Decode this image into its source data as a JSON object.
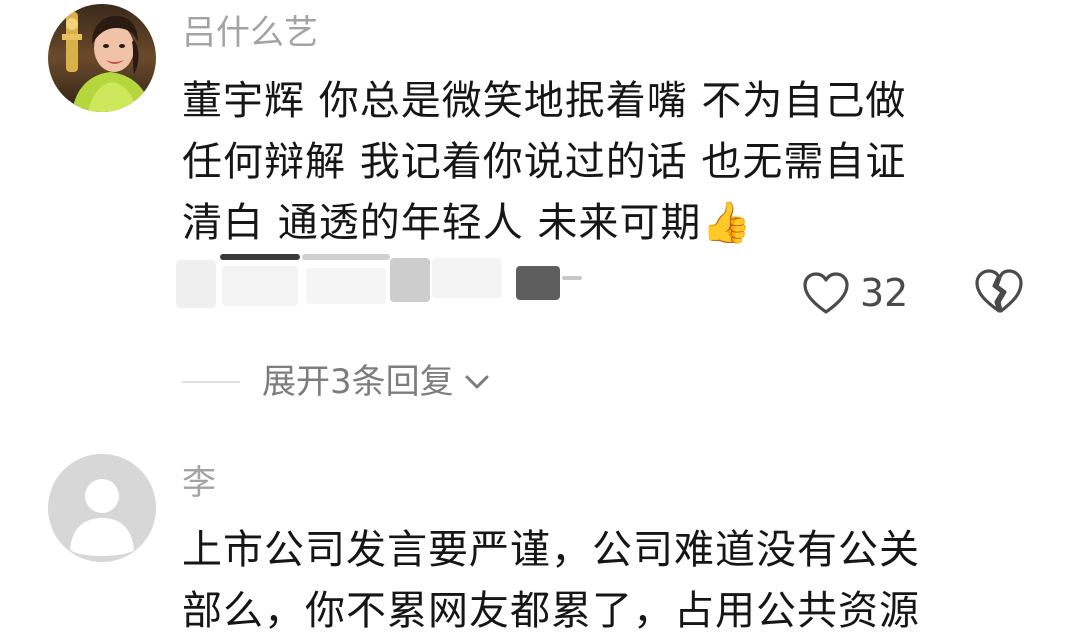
{
  "comments": [
    {
      "username": "吕什么艺",
      "lines": [
        "董宇辉  你总是微笑地抿着嘴  不为自己做",
        "任何辩解  我记着你说过的话  也无需自证",
        "清白  通透的年轻人  未来可期"
      ],
      "emoji": "👍",
      "likes": "32",
      "expand_label": "展开3条回复"
    },
    {
      "username": "李",
      "lines": [
        "上市公司发言要严谨，公司难道没有公关",
        "部么，你不累网友都累了，占用公共资源"
      ]
    }
  ],
  "icons": {
    "like": "heart-outline-icon",
    "dislike": "broken-heart-icon",
    "expand": "chevron-down-icon",
    "default_avatar": "default-user-avatar-icon"
  },
  "colors": {
    "username": "#a3a3a3",
    "body": "#161616",
    "meta": "#7d7d7d",
    "icon": "#4a4a4a",
    "default_avatar_bg": "#d7d7d7"
  }
}
